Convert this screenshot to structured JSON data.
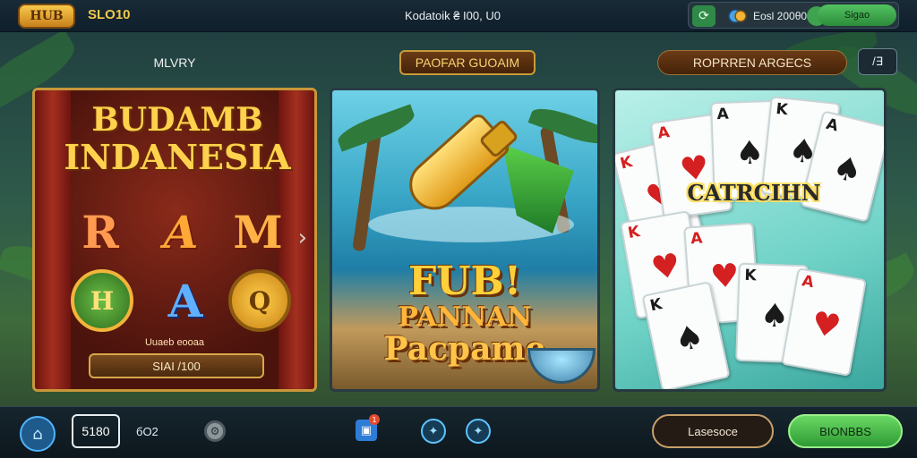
{
  "header": {
    "logo": "HUB",
    "brand": "SLO10",
    "center_text": "Kodatoik ₴ I00, U0",
    "wallet_balance": "Eosl 200θ0",
    "signin_label": "Sigao"
  },
  "sections": {
    "left_label": "MLVRY",
    "mid_label": "PAOFAR GUOAIM",
    "right_label": "ROPRREN ARGECS",
    "extra_label": "/∃"
  },
  "slot_card": {
    "title_line1": "BUDAMB",
    "title_line2": "INDANESIA",
    "symbols": [
      "R",
      "A",
      "M",
      "H",
      "A",
      "Q"
    ],
    "caption": "Uuaeb eooaa",
    "plate": "SIAI /100"
  },
  "fish_card": {
    "title_line1": "FUB!",
    "title_line2": "PANNAN",
    "title_line3": "Pacpame"
  },
  "cards_card": {
    "title": "CATRCIHN",
    "cards": [
      {
        "rank": "K",
        "suit": "♥"
      },
      {
        "rank": "A",
        "suit": "♥"
      },
      {
        "rank": "A",
        "suit": "♠"
      },
      {
        "rank": "K",
        "suit": "♠"
      },
      {
        "rank": "A",
        "suit": "♠"
      },
      {
        "rank": "K",
        "suit": "♥"
      },
      {
        "rank": "A",
        "suit": "♥"
      },
      {
        "rank": "K",
        "suit": "♠"
      },
      {
        "rank": "K",
        "suit": "♠"
      },
      {
        "rank": "A",
        "suit": "♥"
      }
    ]
  },
  "footer": {
    "balance_box": "5180",
    "small_value": "бO2",
    "gift_badge": "1",
    "language_button": "Lasesoce",
    "main_button": "BIONBBS"
  },
  "icons": {
    "home": "home-icon",
    "settings": "settings-icon",
    "gift": "gift-icon",
    "nav": "compass-icon",
    "wallet": "wallet-icon",
    "coin": "coin-icon"
  },
  "colors": {
    "accent_gold": "#f2c94a",
    "accent_green": "#53c262",
    "accent_blue": "#4fb4ff"
  }
}
